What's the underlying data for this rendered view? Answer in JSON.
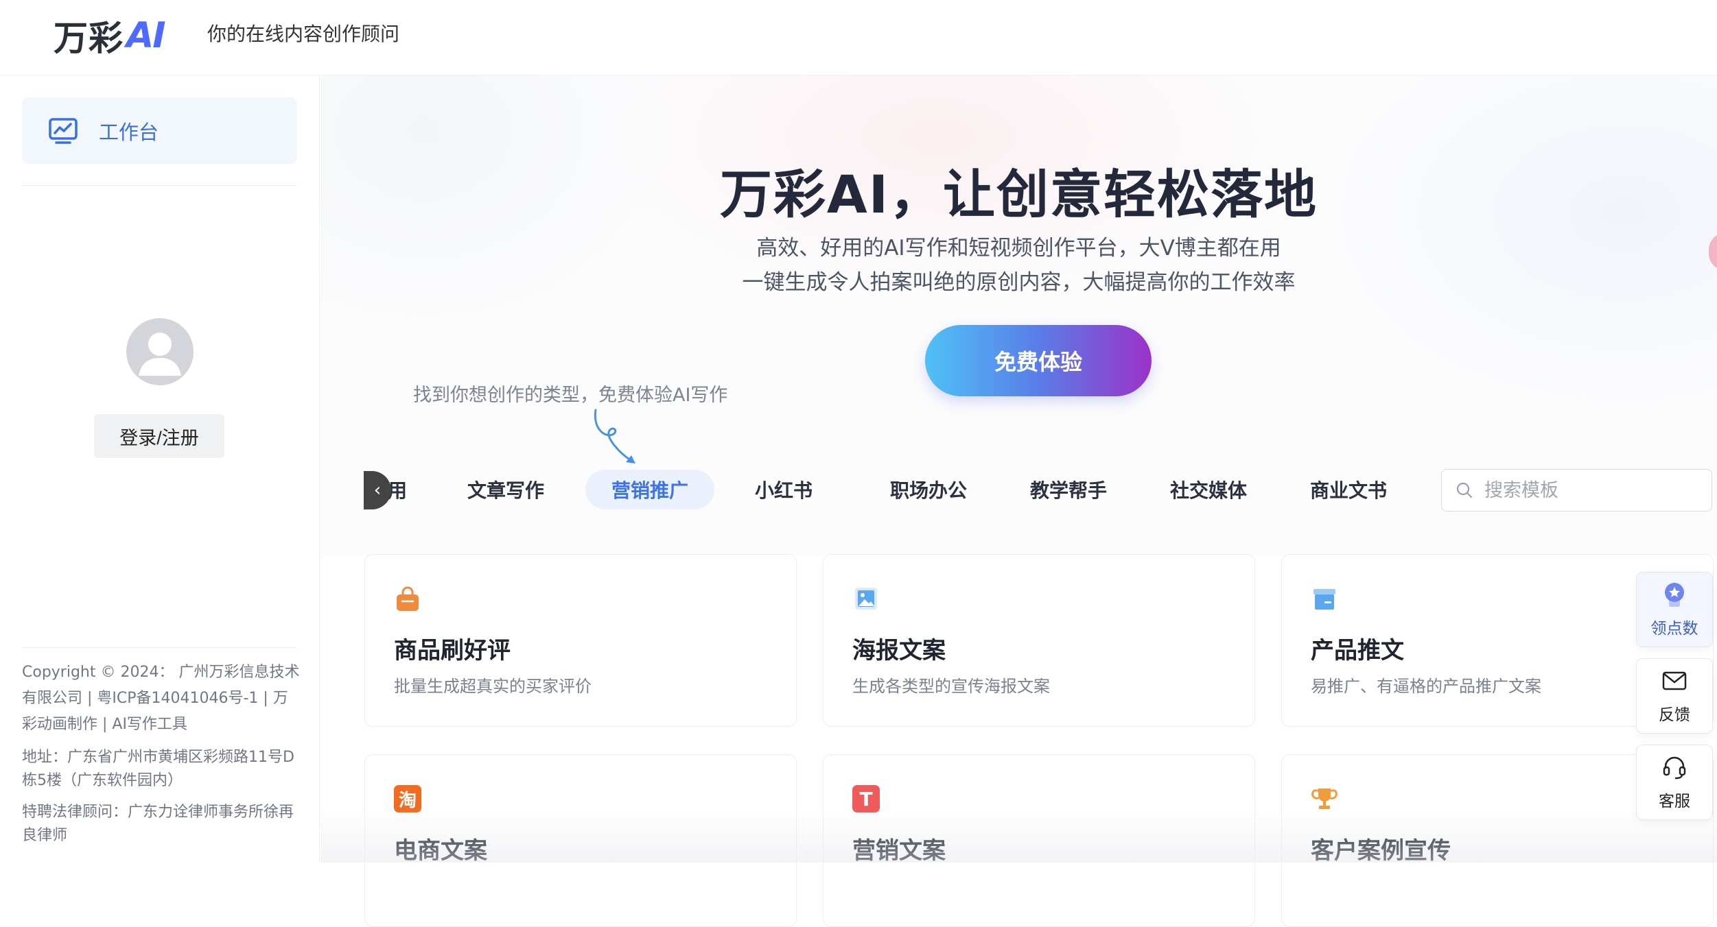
{
  "header": {
    "logo_text": "万彩",
    "logo_ai": "AI",
    "slogan": "你的在线内容创作顾问"
  },
  "sidebar": {
    "nav": [
      {
        "label": "工作台",
        "icon": "chart-monitor-icon"
      }
    ],
    "login_label": "登录/注册",
    "footer": {
      "copyright": "Copyright © 2024： 广州万彩信息技术有限公司 | 粤ICP备14041046号-1 | 万彩动画制作 | AI写作工具",
      "address": "地址：广东省广州市黄埔区彩频路11号D栋5楼（广东软件园内）",
      "lawyer": "特聘法律顾问：广东力诠律师事务所徐再良律师"
    }
  },
  "hero": {
    "title": "万彩AI，让创意轻松落地",
    "subtitle1": "高效、好用的AI写作和短视频创作平台，大V博主都在用",
    "subtitle2": "一键生成令人拍案叫绝的原创内容，大幅提高你的工作效率",
    "cta_label": "免费体验",
    "hint": "找到你想创作的类型，免费体验AI写作"
  },
  "tabs": {
    "prev_icon": "chevron-left-icon",
    "items": [
      {
        "label": "应用",
        "partial_visible": "应用"
      },
      {
        "label": "文章写作"
      },
      {
        "label": "营销推广",
        "active": true
      },
      {
        "label": "小红书"
      },
      {
        "label": "职场办公"
      },
      {
        "label": "教学帮手"
      },
      {
        "label": "社交媒体"
      },
      {
        "label": "商业文书"
      }
    ],
    "search_placeholder": "搜索模板"
  },
  "cards": [
    {
      "title": "商品刷好评",
      "desc": "批量生成超真实的买家评价",
      "icon": "shopping-bag-icon",
      "color": "#f08a3c"
    },
    {
      "title": "海报文案",
      "desc": "生成各类型的宣传海报文案",
      "icon": "image-poster-icon",
      "color": "#5aa7ee"
    },
    {
      "title": "产品推文",
      "desc": "易推广、有逼格的产品推广文案",
      "icon": "box-icon",
      "color": "#5aa7ee"
    },
    {
      "title": "电商文案",
      "desc": "",
      "icon": "taobao-icon",
      "color": "#f36b21",
      "glyph": "淘"
    },
    {
      "title": "营销文案",
      "desc": "",
      "icon": "text-t-icon",
      "color": "#ef5a5a",
      "glyph": "T"
    },
    {
      "title": "客户案例宣传",
      "desc": "",
      "icon": "trophy-icon",
      "color": "#f29b3a"
    }
  ],
  "float_buttons": [
    {
      "label": "领点数",
      "icon": "medal-icon"
    },
    {
      "label": "反馈",
      "icon": "mail-icon"
    },
    {
      "label": "客服",
      "icon": "headset-icon"
    }
  ]
}
